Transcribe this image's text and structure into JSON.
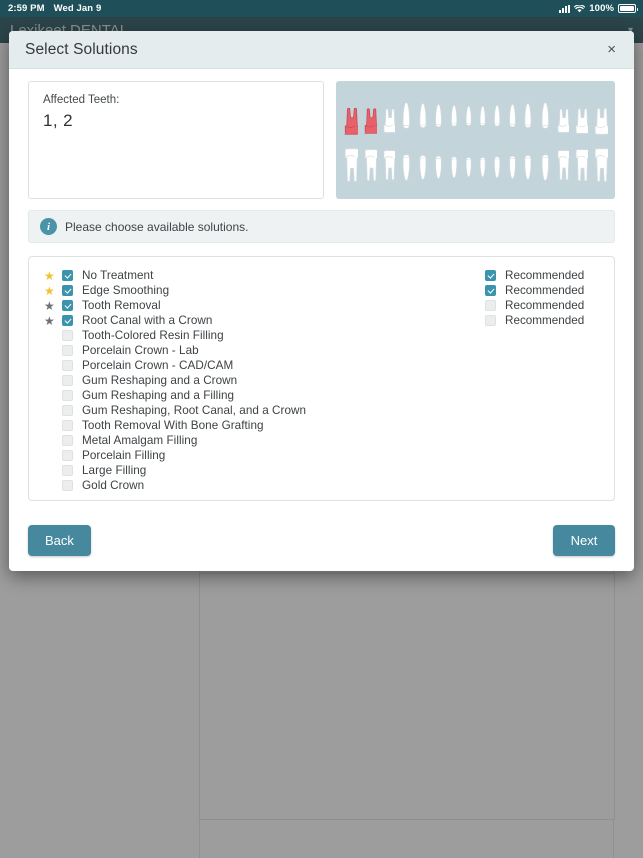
{
  "statusbar": {
    "time": "2:59 PM",
    "date": "Wed Jan 9",
    "battery_percent": "100%",
    "signal_icon": "cellular-signal-icon",
    "wifi_icon": "wifi-icon",
    "battery_icon": "battery-full-icon"
  },
  "app": {
    "title": "Lexikeet DENTAL",
    "menu_caret": "▾"
  },
  "modal": {
    "title": "Select Solutions",
    "close_label": "×",
    "affected_teeth": {
      "label": "Affected Teeth:",
      "value": "1, 2"
    },
    "tooth_chart": {
      "upper_count": 16,
      "lower_count": 16,
      "highlighted_upper": [
        1,
        2
      ],
      "highlight_color": "#e8616a",
      "tooth_color": "#ffffff",
      "background_color": "#c3d4da"
    },
    "info": {
      "icon": "info-circle-icon",
      "glyph": "i",
      "message": "Please choose available solutions."
    },
    "solutions": [
      {
        "label": "No Treatment",
        "star": "gold",
        "checked": true,
        "recommended_label": "Recommended",
        "recommended_checked": true
      },
      {
        "label": "Edge Smoothing",
        "star": "gold",
        "checked": true,
        "recommended_label": "Recommended",
        "recommended_checked": true
      },
      {
        "label": "Tooth Removal",
        "star": "gray",
        "checked": true,
        "recommended_label": "Recommended",
        "recommended_checked": false
      },
      {
        "label": "Root Canal with a Crown",
        "star": "gray",
        "checked": true,
        "recommended_label": "Recommended",
        "recommended_checked": false
      },
      {
        "label": "Tooth-Colored Resin Filling",
        "star": "none",
        "checked": false,
        "recommended_label": "",
        "recommended_checked": null
      },
      {
        "label": "Porcelain Crown - Lab",
        "star": "none",
        "checked": false,
        "recommended_label": "",
        "recommended_checked": null
      },
      {
        "label": "Porcelain Crown - CAD/CAM",
        "star": "none",
        "checked": false,
        "recommended_label": "",
        "recommended_checked": null
      },
      {
        "label": "Gum Reshaping and a Crown",
        "star": "none",
        "checked": false,
        "recommended_label": "",
        "recommended_checked": null
      },
      {
        "label": "Gum Reshaping and a Filling",
        "star": "none",
        "checked": false,
        "recommended_label": "",
        "recommended_checked": null
      },
      {
        "label": "Gum Reshaping, Root Canal, and a Crown",
        "star": "none",
        "checked": false,
        "recommended_label": "",
        "recommended_checked": null
      },
      {
        "label": "Tooth Removal With Bone Grafting",
        "star": "none",
        "checked": false,
        "recommended_label": "",
        "recommended_checked": null
      },
      {
        "label": "Metal Amalgam Filling",
        "star": "none",
        "checked": false,
        "recommended_label": "",
        "recommended_checked": null
      },
      {
        "label": "Porcelain Filling",
        "star": "none",
        "checked": false,
        "recommended_label": "",
        "recommended_checked": null
      },
      {
        "label": "Large Filling",
        "star": "none",
        "checked": false,
        "recommended_label": "",
        "recommended_checked": null
      },
      {
        "label": "Gold Crown",
        "star": "none",
        "checked": false,
        "recommended_label": "",
        "recommended_checked": null
      }
    ],
    "footer": {
      "back_label": "Back",
      "next_label": "Next"
    }
  },
  "colors": {
    "accent_teal": "#46899e",
    "checkbox_teal": "#3b93ad",
    "star_gold": "#f2c230",
    "star_gray": "#6e7275",
    "statusbar_bg": "#1f5059",
    "appbar_bg": "#1d4f58",
    "modal_header_bg": "#e4ecee"
  }
}
